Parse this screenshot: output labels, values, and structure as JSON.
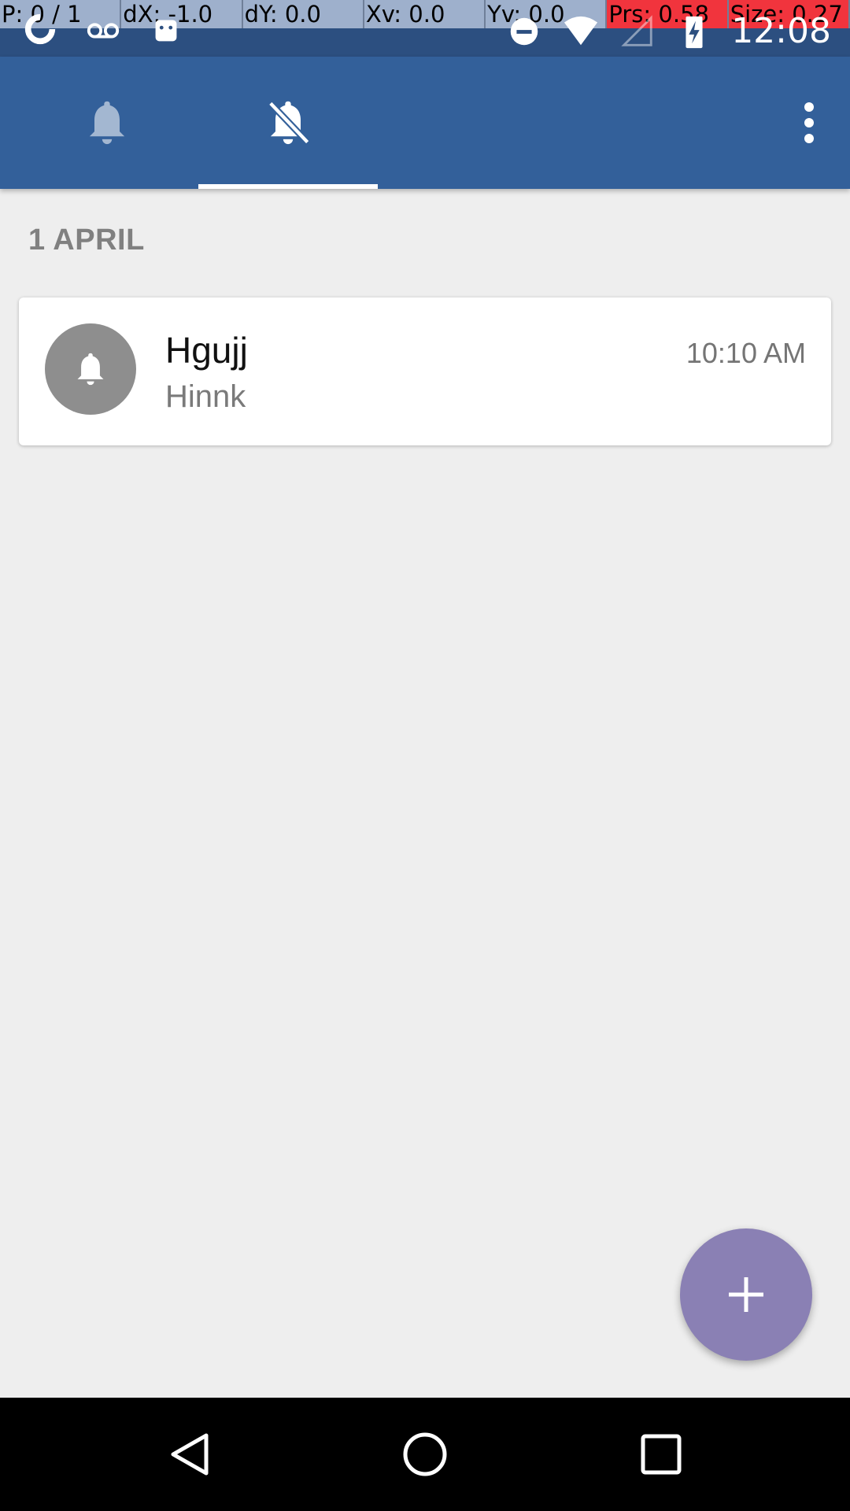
{
  "status_bar": {
    "debug": {
      "pointer": "P: 0 / 1",
      "dx": "dX: -1.0",
      "dy": "dY: 0.0",
      "xv": "Xv: 0.0",
      "yv": "Yv: 0.0",
      "prs": "Prs: 0.58",
      "size": "Size: 0.27"
    },
    "time": "12:08",
    "left_icons": [
      "app-icon",
      "voicemail-icon",
      "android-icon"
    ],
    "right_icons": [
      "do-not-disturb-icon",
      "wifi-icon",
      "no-signal-icon",
      "battery-charging-icon"
    ]
  },
  "app_bar": {
    "tabs": [
      {
        "icon": "bell-icon",
        "selected": false
      },
      {
        "icon": "bell-off-icon",
        "selected": true
      }
    ],
    "overflow_icon": "more-vert-icon"
  },
  "content": {
    "section_header": "1 APRIL",
    "notifications": [
      {
        "title": "Hgujj",
        "subtitle": "Hinnk",
        "time": "10:10 AM",
        "icon": "bell-icon"
      }
    ]
  },
  "fab": {
    "icon": "plus-icon"
  },
  "nav_bar": {
    "icons": [
      "back-icon",
      "home-icon",
      "recents-icon"
    ]
  },
  "colors": {
    "app_bar": "#33609a",
    "status_bar": "#2c4f80",
    "fab": "#8a80b4",
    "background": "#eeeeee",
    "avatar": "#8e8e8e"
  }
}
